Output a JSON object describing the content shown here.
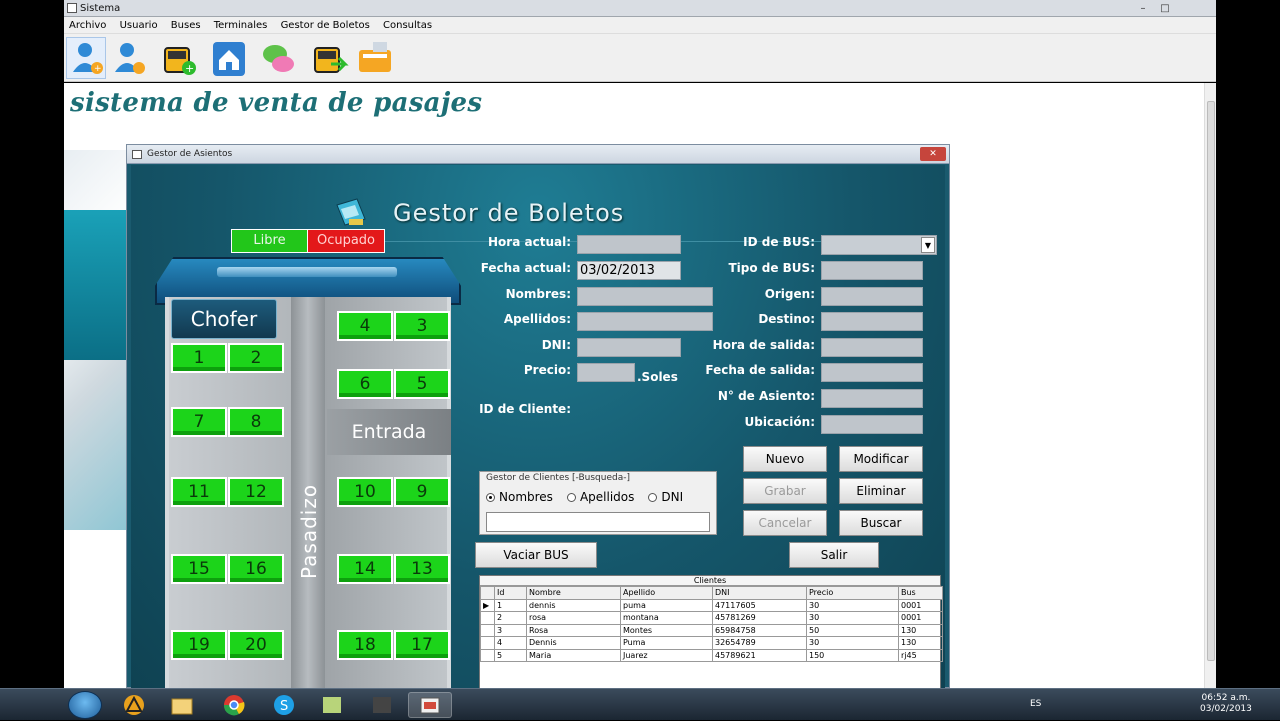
{
  "app": {
    "title": "Sistema",
    "menu": [
      "Archivo",
      "Usuario",
      "Buses",
      "Terminales",
      "Gestor de Boletos",
      "Consultas"
    ],
    "banner": "sistema de venta de pasajes"
  },
  "dialog": {
    "title": "Gestor de Asientos",
    "header": "Gestor de Boletos"
  },
  "legend": {
    "libre": "Libre",
    "ocupado": "Ocupado"
  },
  "bus": {
    "chofer": "Chofer",
    "entrada": "Entrada",
    "pasadizo": "Pasadizo",
    "seats": [
      "1",
      "2",
      "3",
      "4",
      "5",
      "6",
      "7",
      "8",
      "9",
      "10",
      "11",
      "12",
      "13",
      "14",
      "15",
      "16",
      "17",
      "18",
      "19",
      "20"
    ]
  },
  "form": {
    "hora_actual": "Hora actual:",
    "fecha_actual": "Fecha actual:",
    "fecha_value": "03/02/2013",
    "nombres": "Nombres:",
    "apellidos": "Apellidos:",
    "dni": "DNI:",
    "precio": "Precio:",
    "soles": ".Soles",
    "id_cliente": "ID de Cliente:",
    "id_bus": "ID de BUS:",
    "tipo_bus": "Tipo de BUS:",
    "origen": "Origen:",
    "destino": "Destino:",
    "hora_salida": "Hora de salida:",
    "fecha_salida": "Fecha de salida:",
    "n_asiento": "N° de Asiento:",
    "ubicacion": "Ubicación:"
  },
  "buttons": {
    "nuevo": "Nuevo",
    "modificar": "Modificar",
    "grabar": "Grabar",
    "eliminar": "Eliminar",
    "cancelar": "Cancelar",
    "buscar": "Buscar",
    "vaciar": "Vaciar BUS",
    "salir": "Salir"
  },
  "search": {
    "title": "Gestor de Clientes [-Busqueda-]",
    "options": [
      "Nombres",
      "Apellidos",
      "DNI"
    ],
    "selected": "Nombres"
  },
  "grid": {
    "caption": "Clientes",
    "columns": [
      "Id",
      "Nombre",
      "Apellido",
      "DNI",
      "Precio",
      "Bus"
    ],
    "rows": [
      [
        "1",
        "dennis",
        "puma",
        "47117605",
        "30",
        "0001"
      ],
      [
        "2",
        "rosa",
        "montana",
        "45781269",
        "30",
        "0001"
      ],
      [
        "3",
        "Rosa",
        "Montes",
        "65984758",
        "50",
        "130"
      ],
      [
        "4",
        "Dennis",
        "Puma",
        "32654789",
        "30",
        "130"
      ],
      [
        "5",
        "Maria",
        "Juarez",
        "45789621",
        "150",
        "rj45"
      ]
    ]
  },
  "taskbar": {
    "lang": "ES",
    "time": "06:52 a.m.",
    "date": "03/02/2013"
  },
  "colors": {
    "libre": "#22c61a",
    "ocupado": "#e3181a",
    "accent": "#1a5a6e"
  }
}
